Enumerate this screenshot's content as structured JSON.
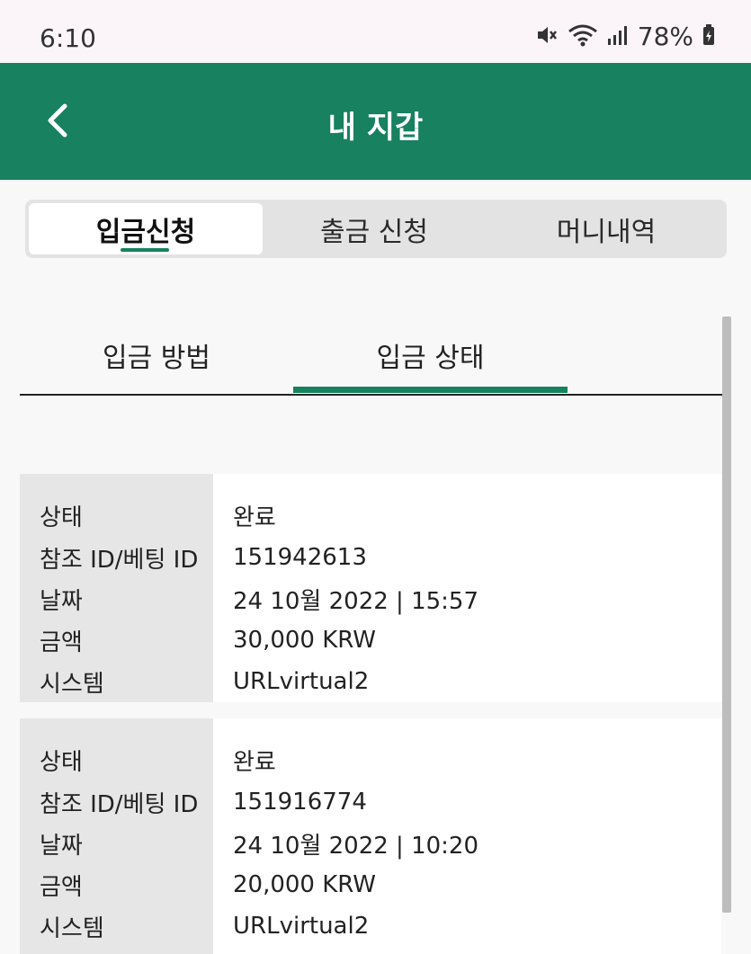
{
  "status_bar": {
    "time": "6:10",
    "battery": "78%"
  },
  "header": {
    "title": "내 지갑"
  },
  "segments": [
    {
      "label": "입금신청",
      "active": true
    },
    {
      "label": "출금 신청",
      "active": false
    },
    {
      "label": "머니내역",
      "active": false
    }
  ],
  "subtabs": [
    {
      "label": "입금 방법",
      "active": false
    },
    {
      "label": "입금 상태",
      "active": true
    }
  ],
  "colors": {
    "primary": "#178160",
    "label_bg": "#e6e6e6"
  },
  "records": [
    {
      "rows": [
        {
          "label": "상태",
          "value": "완료"
        },
        {
          "label": "참조 ID/베팅 ID",
          "value": "151942613"
        },
        {
          "label": "날짜",
          "value": "24 10월 2022 | 15:57"
        },
        {
          "label": "금액",
          "value": "30,000 KRW"
        },
        {
          "label": "시스템",
          "value": "URLvirtual2"
        }
      ]
    },
    {
      "rows": [
        {
          "label": "상태",
          "value": "완료"
        },
        {
          "label": "참조 ID/베팅 ID",
          "value": "151916774"
        },
        {
          "label": "날짜",
          "value": "24 10월 2022 | 10:20"
        },
        {
          "label": "금액",
          "value": "20,000 KRW"
        },
        {
          "label": "시스템",
          "value": "URLvirtual2"
        }
      ]
    }
  ]
}
